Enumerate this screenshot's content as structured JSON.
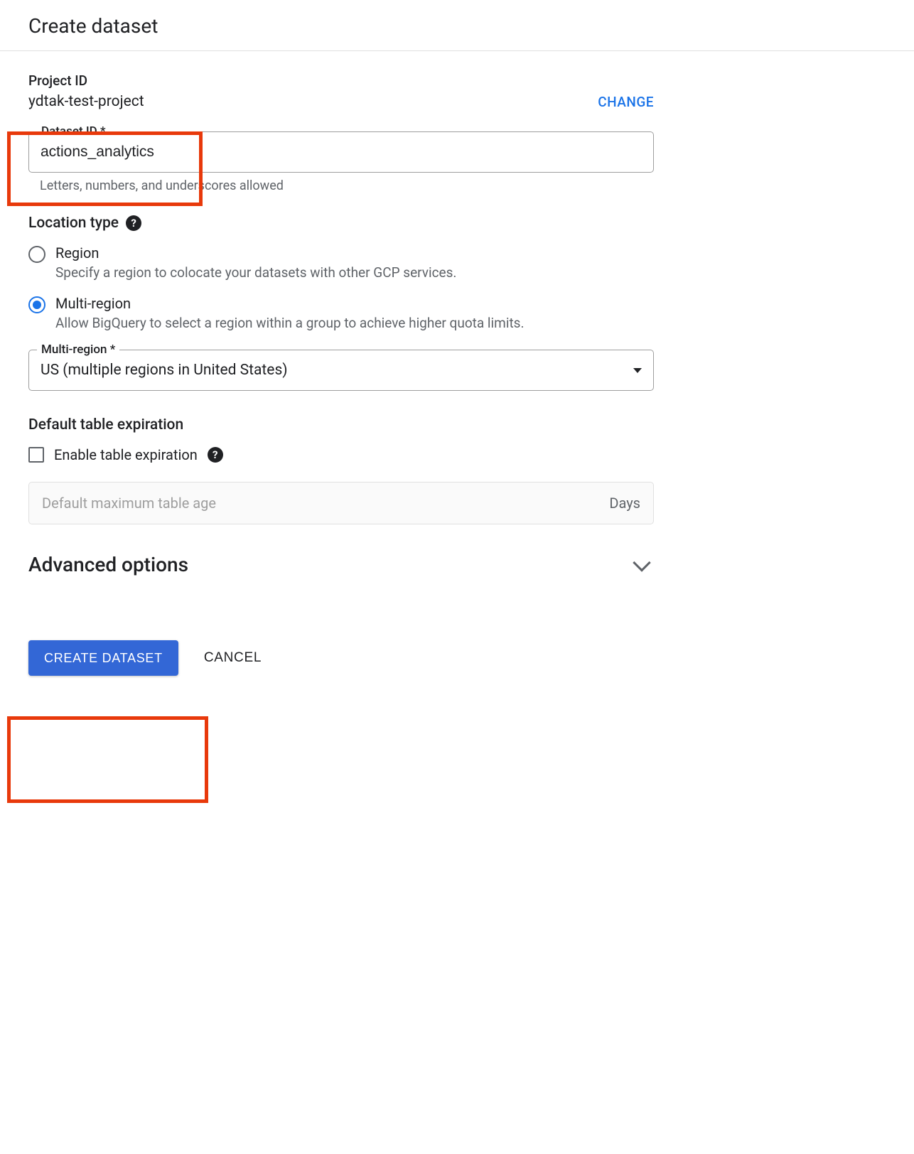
{
  "page_title": "Create dataset",
  "project": {
    "label": "Project ID",
    "value": "ydtak-test-project",
    "change_label": "CHANGE"
  },
  "dataset_id": {
    "label": "Dataset ID *",
    "value": "actions_analytics",
    "helper": "Letters, numbers, and underscores allowed"
  },
  "location": {
    "heading": "Location type",
    "options": [
      {
        "title": "Region",
        "desc": "Specify a region to colocate your datasets with other GCP services.",
        "selected": false
      },
      {
        "title": "Multi-region",
        "desc": "Allow BigQuery to select a region within a group to achieve higher quota limits.",
        "selected": true
      }
    ]
  },
  "multi_region": {
    "label": "Multi-region *",
    "value": "US (multiple regions in United States)"
  },
  "expiration": {
    "heading": "Default table expiration",
    "checkbox_label": "Enable table expiration",
    "placeholder": "Default maximum table age",
    "suffix": "Days"
  },
  "advanced": {
    "title": "Advanced options"
  },
  "buttons": {
    "create": "CREATE DATASET",
    "cancel": "CANCEL"
  }
}
